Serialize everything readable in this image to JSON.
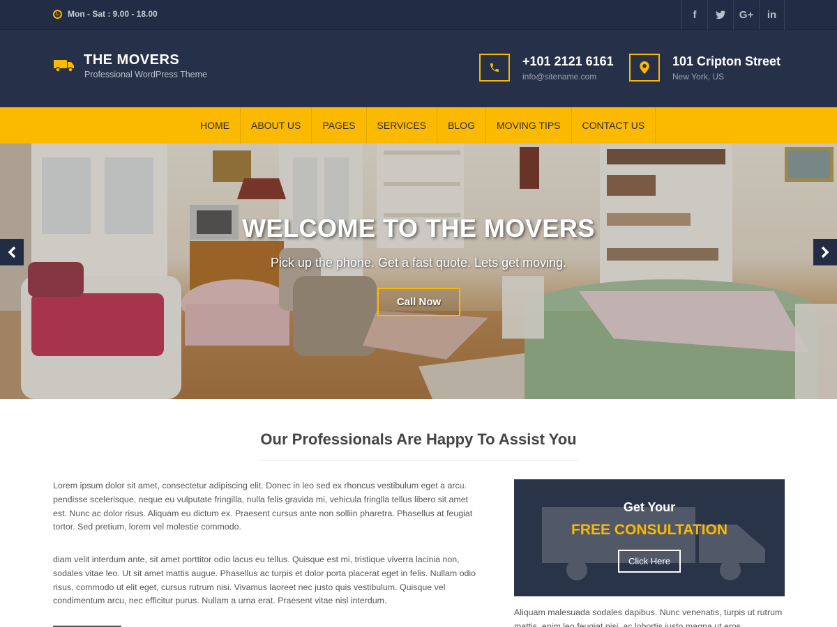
{
  "topbar": {
    "hours": "Mon - Sat : 9.00 - 18.00",
    "social": [
      {
        "icon": "facebook-icon",
        "glyph": "f"
      },
      {
        "icon": "twitter-icon",
        "glyph": "t"
      },
      {
        "icon": "google-plus-icon",
        "glyph": "G+"
      },
      {
        "icon": "linkedin-icon",
        "glyph": "in"
      }
    ]
  },
  "header": {
    "title": "THE MOVERS",
    "subtitle": "Professional WordPress Theme",
    "phone": "+101 2121 6161",
    "email": "info@sitename.com",
    "street": "101 Cripton Street",
    "city": "New York, US"
  },
  "nav": {
    "items": [
      "HOME",
      "ABOUT US",
      "PAGES",
      "SERVICES",
      "BLOG",
      "MOVING TIPS",
      "CONTACT US"
    ]
  },
  "hero": {
    "title": "WELCOME TO THE MOVERS",
    "tagline": "Pick up the phone. Get a fast quote. Lets get moving.",
    "cta": "Call Now"
  },
  "main": {
    "heading": "Our Professionals Are Happy To Assist You",
    "paragraph1": "Lorem ipsum dolor sit amet, consectetur adipiscing elit. Donec in leo sed ex rhoncus vestibulum eget a arcu. pendisse scelerisque, neque eu vulputate fringilla, nulla felis gravida mi, vehicula fringlla tellus libero sit amet est. Nunc ac dolor risus. Aliquam eu dictum ex. Praesent cursus ante non solliin pharetra. Phasellus at feugiat tortor. Sed pretium, lorem vel molestie commodo.",
    "paragraph2": "diam velit interdum ante, sit amet porttitor odio lacus eu tellus. Quisque est mi, tristique viverra lacinia non, sodales vitae leo. Ut sit amet mattis augue. Phasellus ac turpis et dolor porta placerat eget in felis. Nullam odio risus, commodo ut elit eget, cursus rutrum nisi. Vivamus laoreet nec justo quis vestibulum. Quisque vel condimentum arcu, nec efficitur purus. Nullam a urna erat. Praesent vitae nisl interdum."
  },
  "consultation": {
    "line1": "Get Your",
    "line2": "FREE CONSULTATION",
    "button": "Click Here",
    "text": "Aliquam malesuada sodales dapibus. Nunc venenatis, turpis ut rutrum mattis, enim leo feugiat nisi, ac lobortis justo magna ut eros."
  },
  "colors": {
    "accent": "#fbb900",
    "navy": "#263149",
    "topbar": "#222d45"
  }
}
